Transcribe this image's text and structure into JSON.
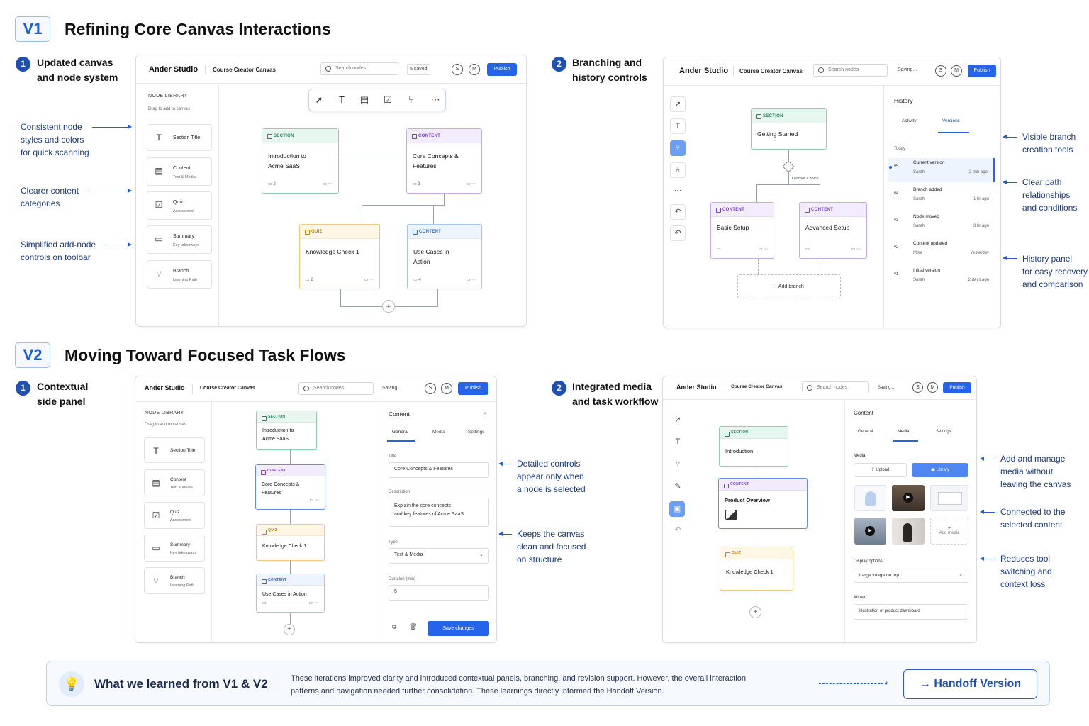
{
  "v1": {
    "tag": "V1",
    "title": "Refining Core Canvas Interactions",
    "p1": {
      "num": "1",
      "title": "Updated canvas\nand node system",
      "notes": [
        "Consistent node\nstyles and colors\nfor quick scanning",
        "Clearer content\ncategories",
        "Simplified add-node\ncontrols on toolbar"
      ],
      "app": {
        "brand": "Ander Studio",
        "project": "Course Creator Canvas",
        "search": "Search nodes",
        "status": "5 saved",
        "avatars": [
          "S",
          "M"
        ],
        "publish": "Publish",
        "lib_title": "NODE LIBRARY",
        "lib_sub": "Drag to add to canvas",
        "lib_items": [
          {
            "t": "Section Title",
            "s": ""
          },
          {
            "t": "Content",
            "s": "Text & Media"
          },
          {
            "t": "Quiz",
            "s": "Assessment"
          },
          {
            "t": "Summary",
            "s": "Key takeaways"
          },
          {
            "t": "Branch",
            "s": "Learning Path"
          }
        ],
        "nodes": [
          {
            "type": "SECTION",
            "title": "Introduction to\nAcme SaaS",
            "count": "2"
          },
          {
            "type": "CONTENT",
            "title": "Core Concepts &\nFeatures",
            "count": "3"
          },
          {
            "type": "QUIZ",
            "title": "Knowledge Check 1",
            "count": "2"
          },
          {
            "type": "CONTENT",
            "title": "Use Cases in\nAction",
            "count": "4"
          }
        ]
      }
    },
    "p2": {
      "num": "2",
      "title": "Branching and\nhistory controls",
      "notes": [
        "Visible branch\ncreation tools",
        "Clear path\nrelationships\nand conditions",
        "History panel\nfor easy recovery\nand comparison"
      ],
      "app": {
        "brand": "Ander Studio",
        "project": "Course Creator Canvas",
        "search": "Search nodes",
        "status": "Saving...",
        "avatars": [
          "S",
          "M"
        ],
        "publish": "Publish",
        "nodes": [
          {
            "type": "SECTION",
            "title": "Getting Started"
          },
          {
            "type": "CONTENT",
            "title": "Basic Setup"
          },
          {
            "type": "CONTENT",
            "title": "Advanced Setup"
          }
        ],
        "decision": "Learner Choice",
        "add_branch": "Add branch",
        "history": {
          "title": "History",
          "tabs": [
            "Activity",
            "Versions"
          ],
          "group": "Today",
          "items": [
            {
              "v": "v5",
              "t": "Current version",
              "u": "Sarah",
              "time": "2 min ago"
            },
            {
              "v": "v4",
              "t": "Branch added",
              "u": "Sarah",
              "time": "1 hr ago"
            },
            {
              "v": "v3",
              "t": "Node moved",
              "u": "Sarah",
              "time": "3 hr ago"
            },
            {
              "v": "v2",
              "t": "Content updated",
              "u": "Mike",
              "time": "Yesterday"
            },
            {
              "v": "v1",
              "t": "Initial version",
              "u": "Sarah",
              "time": "2 days ago"
            }
          ]
        }
      }
    }
  },
  "v2": {
    "tag": "V2",
    "title": "Moving Toward Focused Task Flows",
    "p1": {
      "num": "1",
      "title": "Contextual\nside panel",
      "notes": [
        "Detailed controls\nappear only when\na node is selected",
        "Keeps the canvas\nclean and focused\non structure"
      ],
      "app": {
        "brand": "Ander Studio",
        "project": "Course Creator Canvas",
        "search": "Search nodes",
        "status": "Saving...",
        "avatars": [
          "S",
          "M"
        ],
        "publish": "Publish",
        "lib_title": "NODE LIBRARY",
        "lib_sub": "Drag to add to canvas",
        "lib_items": [
          {
            "t": "Section Title",
            "s": ""
          },
          {
            "t": "Content",
            "s": "Text & Media"
          },
          {
            "t": "Quiz",
            "s": "Assessment"
          },
          {
            "t": "Summary",
            "s": "Key takeaways"
          },
          {
            "t": "Branch",
            "s": "Learning Path"
          }
        ],
        "nodes": [
          {
            "type": "SECTION",
            "title": "Introduction to\nAcme SaaS"
          },
          {
            "type": "CONTENT",
            "title": "Core Concepts &\nFeatures"
          },
          {
            "type": "QUIZ",
            "title": "Knowledge Check 1"
          },
          {
            "type": "CONTENT",
            "title": "Use Cases in Action"
          }
        ],
        "panel": {
          "title": "Content",
          "tabs": [
            "General",
            "Media",
            "Settings"
          ],
          "title_label": "Title",
          "title_value": "Core Concepts & Features",
          "desc_label": "Description",
          "desc_value": "Explain the core concepts\nand key features of Acme SaaS.",
          "type_label": "Type",
          "type_value": "Text & Media",
          "dur_label": "Duration (min)",
          "dur_value": "5",
          "save": "Save changes"
        }
      }
    },
    "p2": {
      "num": "2",
      "title": "Integrated media\nand task workflow",
      "notes": [
        "Add and manage\nmedia without\nleaving the canvas",
        "Connected to the\nselected content",
        "Reduces tool\nswitching and\ncontext loss"
      ],
      "app": {
        "brand": "Ander Studio",
        "project": "Course Creator Canvas",
        "search": "Search nodes",
        "status": "Saving...",
        "avatars": [
          "S",
          "M"
        ],
        "publish": "Publish",
        "nodes": [
          {
            "type": "SECTION",
            "title": "Introduction"
          },
          {
            "type": "CONTENT",
            "title": "Product Overview"
          },
          {
            "type": "QUIZ",
            "title": "Knowledge Check 1"
          }
        ],
        "panel": {
          "title": "Content",
          "tabs": [
            "General",
            "Media",
            "Settings"
          ],
          "media_label": "Media",
          "upload": "Upload",
          "library": "Library",
          "add_media": "Add media",
          "display_label": "Display options",
          "display_value": "Large image on top",
          "alt_label": "Alt text",
          "alt_value": "Illustration of product dashboard"
        }
      }
    }
  },
  "footer": {
    "title": "What we learned from V1 & V2",
    "text": "These iterations improved clarity and introduced contextual panels, branching, and revision support. However, the overall interaction\npatterns and navigation needed further consolidation. These learnings directly informed the Handoff Version.",
    "cta": "Handoff Version"
  },
  "colors": {
    "accent": "#2563eb",
    "section": "#1c8a62",
    "content": "#7b3fd4",
    "quiz": "#c48208",
    "content_blue": "#2b68c5"
  }
}
